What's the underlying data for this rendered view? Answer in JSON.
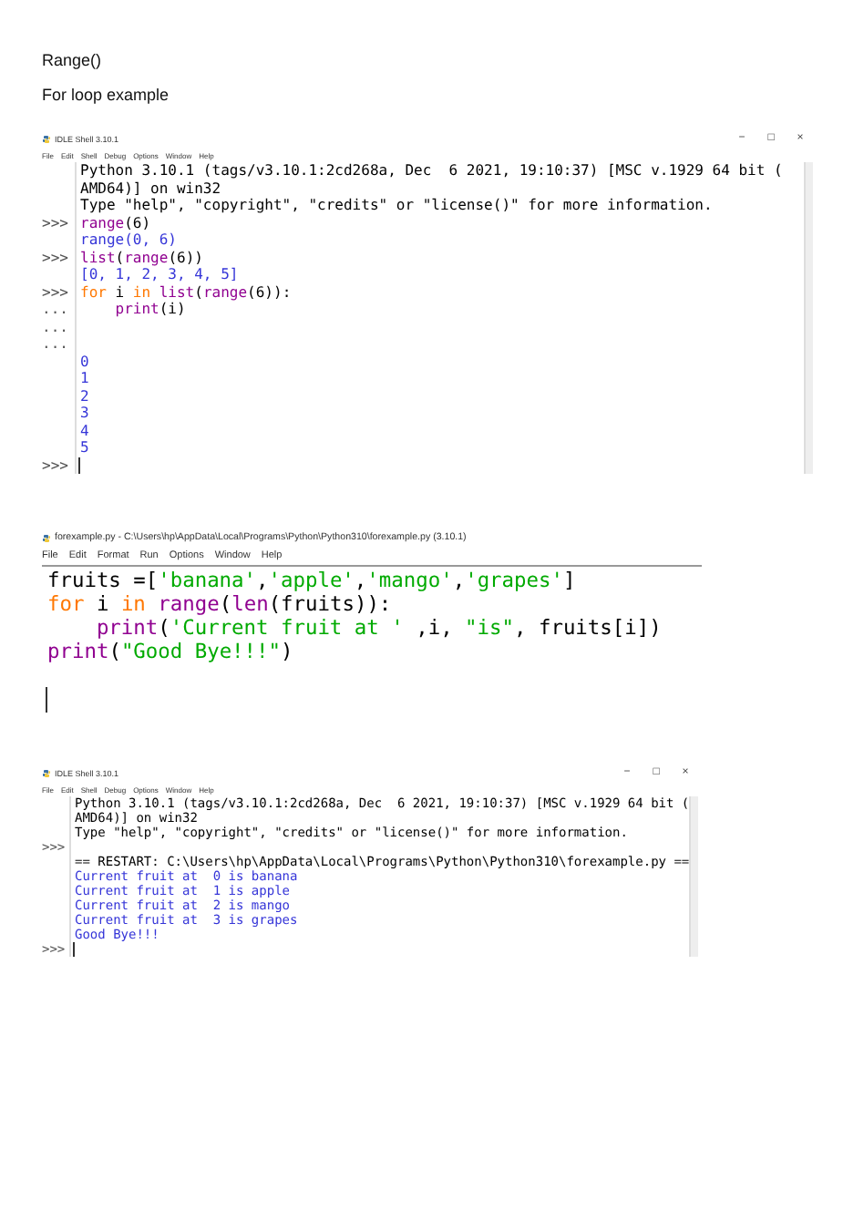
{
  "headings": [
    "Range()",
    "For loop example"
  ],
  "windows": [
    {
      "kind": "shell",
      "title": "IDLE Shell 3.10.1",
      "controls": [
        "−",
        "□",
        "×"
      ],
      "menu": [
        "File",
        "Edit",
        "Shell",
        "Debug",
        "Options",
        "Window",
        "Help"
      ],
      "lines": [
        {
          "segments": [
            {
              "kind": "plain",
              "text": "Python 3.10.1 (tags/v3.10.1:2cd268a, Dec  6 2021, 19:10:37) [MSC v.1929 64 bit ("
            }
          ]
        },
        {
          "segments": [
            {
              "kind": "plain",
              "text": "AMD64)] on win32"
            }
          ]
        },
        {
          "segments": [
            {
              "kind": "plain",
              "text": "Type \"help\", \"copyright\", \"credits\" or \"license()\" for more information."
            }
          ]
        },
        {
          "prompt": ">>>",
          "segments": [
            {
              "kind": "builtin",
              "text": "range"
            },
            {
              "kind": "plain",
              "text": "(6)"
            }
          ]
        },
        {
          "segments": [
            {
              "kind": "output",
              "text": "range(0, 6)"
            }
          ]
        },
        {
          "prompt": ">>>",
          "segments": [
            {
              "kind": "builtin",
              "text": "list"
            },
            {
              "kind": "plain",
              "text": "("
            },
            {
              "kind": "builtin",
              "text": "range"
            },
            {
              "kind": "plain",
              "text": "(6))"
            }
          ]
        },
        {
          "segments": [
            {
              "kind": "output",
              "text": "[0, 1, 2, 3, 4, 5]"
            }
          ]
        },
        {
          "prompt": ">>>",
          "segments": [
            {
              "kind": "keyword",
              "text": "for"
            },
            {
              "kind": "plain",
              "text": " i "
            },
            {
              "kind": "keyword",
              "text": "in "
            },
            {
              "kind": "builtin",
              "text": "list"
            },
            {
              "kind": "plain",
              "text": "("
            },
            {
              "kind": "builtin",
              "text": "range"
            },
            {
              "kind": "plain",
              "text": "(6)):"
            }
          ]
        },
        {
          "prompt": "...",
          "indent": true,
          "segments": [
            {
              "kind": "builtin",
              "text": "print"
            },
            {
              "kind": "plain",
              "text": "(i)"
            }
          ]
        },
        {
          "prompt": "..."
        },
        {
          "prompt": "..."
        },
        {
          "segments": [
            {
              "kind": "output",
              "text": "0"
            }
          ]
        },
        {
          "segments": [
            {
              "kind": "output",
              "text": "1"
            }
          ]
        },
        {
          "segments": [
            {
              "kind": "output",
              "text": "2"
            }
          ]
        },
        {
          "segments": [
            {
              "kind": "output",
              "text": "3"
            }
          ]
        },
        {
          "segments": [
            {
              "kind": "output",
              "text": "4"
            }
          ]
        },
        {
          "segments": [
            {
              "kind": "output",
              "text": "5"
            }
          ]
        },
        {
          "prompt": ">>>",
          "cursor": true
        }
      ]
    },
    {
      "kind": "editor",
      "title": "forexample.py - C:\\Users\\hp\\AppData\\Local\\Programs\\Python\\Python310\\forexample.py (3.10.1)",
      "menu": [
        "File",
        "Edit",
        "Format",
        "Run",
        "Options",
        "Window",
        "Help"
      ],
      "lines": [
        {
          "segments": [
            {
              "kind": "plain",
              "text": "fruits =["
            },
            {
              "kind": "string",
              "text": "'banana'"
            },
            {
              "kind": "plain",
              "text": ","
            },
            {
              "kind": "string",
              "text": "'apple'"
            },
            {
              "kind": "plain",
              "text": ","
            },
            {
              "kind": "string",
              "text": "'mango'"
            },
            {
              "kind": "plain",
              "text": ","
            },
            {
              "kind": "string",
              "text": "'grapes'"
            },
            {
              "kind": "plain",
              "text": "]"
            }
          ]
        },
        {
          "segments": [
            {
              "kind": "keyword",
              "text": "for"
            },
            {
              "kind": "plain",
              "text": " i "
            },
            {
              "kind": "keyword",
              "text": "in "
            },
            {
              "kind": "builtin",
              "text": "range"
            },
            {
              "kind": "plain",
              "text": "("
            },
            {
              "kind": "builtin",
              "text": "len"
            },
            {
              "kind": "plain",
              "text": "(fruits)):"
            }
          ]
        },
        {
          "indent": true,
          "segments": [
            {
              "kind": "builtin",
              "text": "print"
            },
            {
              "kind": "plain",
              "text": "("
            },
            {
              "kind": "string",
              "text": "'Current fruit at '"
            },
            {
              "kind": "plain",
              "text": " ,i, "
            },
            {
              "kind": "string",
              "text": "\"is\""
            },
            {
              "kind": "plain",
              "text": ", fruits[i])"
            }
          ]
        },
        {
          "segments": [
            {
              "kind": "builtin",
              "text": "print"
            },
            {
              "kind": "plain",
              "text": "("
            },
            {
              "kind": "string",
              "text": "\"Good Bye!!!\""
            },
            {
              "kind": "plain",
              "text": ")"
            }
          ]
        },
        {
          "cursor": true
        }
      ]
    },
    {
      "kind": "shell",
      "title": "IDLE Shell 3.10.1",
      "controls": [
        "−",
        "□",
        "×"
      ],
      "menu": [
        "File",
        "Edit",
        "Shell",
        "Debug",
        "Options",
        "Window",
        "Help"
      ],
      "lines": [
        {
          "segments": [
            {
              "kind": "plain",
              "text": "Python 3.10.1 (tags/v3.10.1:2cd268a, Dec  6 2021, 19:10:37) [MSC v.1929 64 bit ("
            }
          ]
        },
        {
          "segments": [
            {
              "kind": "plain",
              "text": "AMD64)] on win32"
            }
          ]
        },
        {
          "segments": [
            {
              "kind": "plain",
              "text": "Type \"help\", \"copyright\", \"credits\" or \"license()\" for more information."
            }
          ]
        },
        {
          "prompt": ">>>"
        },
        {
          "segments": [
            {
              "kind": "plain",
              "text": "== RESTART: C:\\Users\\hp\\AppData\\Local\\Programs\\Python\\Python310\\forexample.py =="
            }
          ]
        },
        {
          "segments": [
            {
              "kind": "output",
              "text": "Current fruit at  0 is banana"
            }
          ]
        },
        {
          "segments": [
            {
              "kind": "output",
              "text": "Current fruit at  1 is apple"
            }
          ]
        },
        {
          "segments": [
            {
              "kind": "output",
              "text": "Current fruit at  2 is mango"
            }
          ]
        },
        {
          "segments": [
            {
              "kind": "output",
              "text": "Current fruit at  3 is grapes"
            }
          ]
        },
        {
          "segments": [
            {
              "kind": "output",
              "text": "Good Bye!!!"
            }
          ]
        },
        {
          "prompt": ">>>",
          "cursor": true
        }
      ]
    }
  ]
}
